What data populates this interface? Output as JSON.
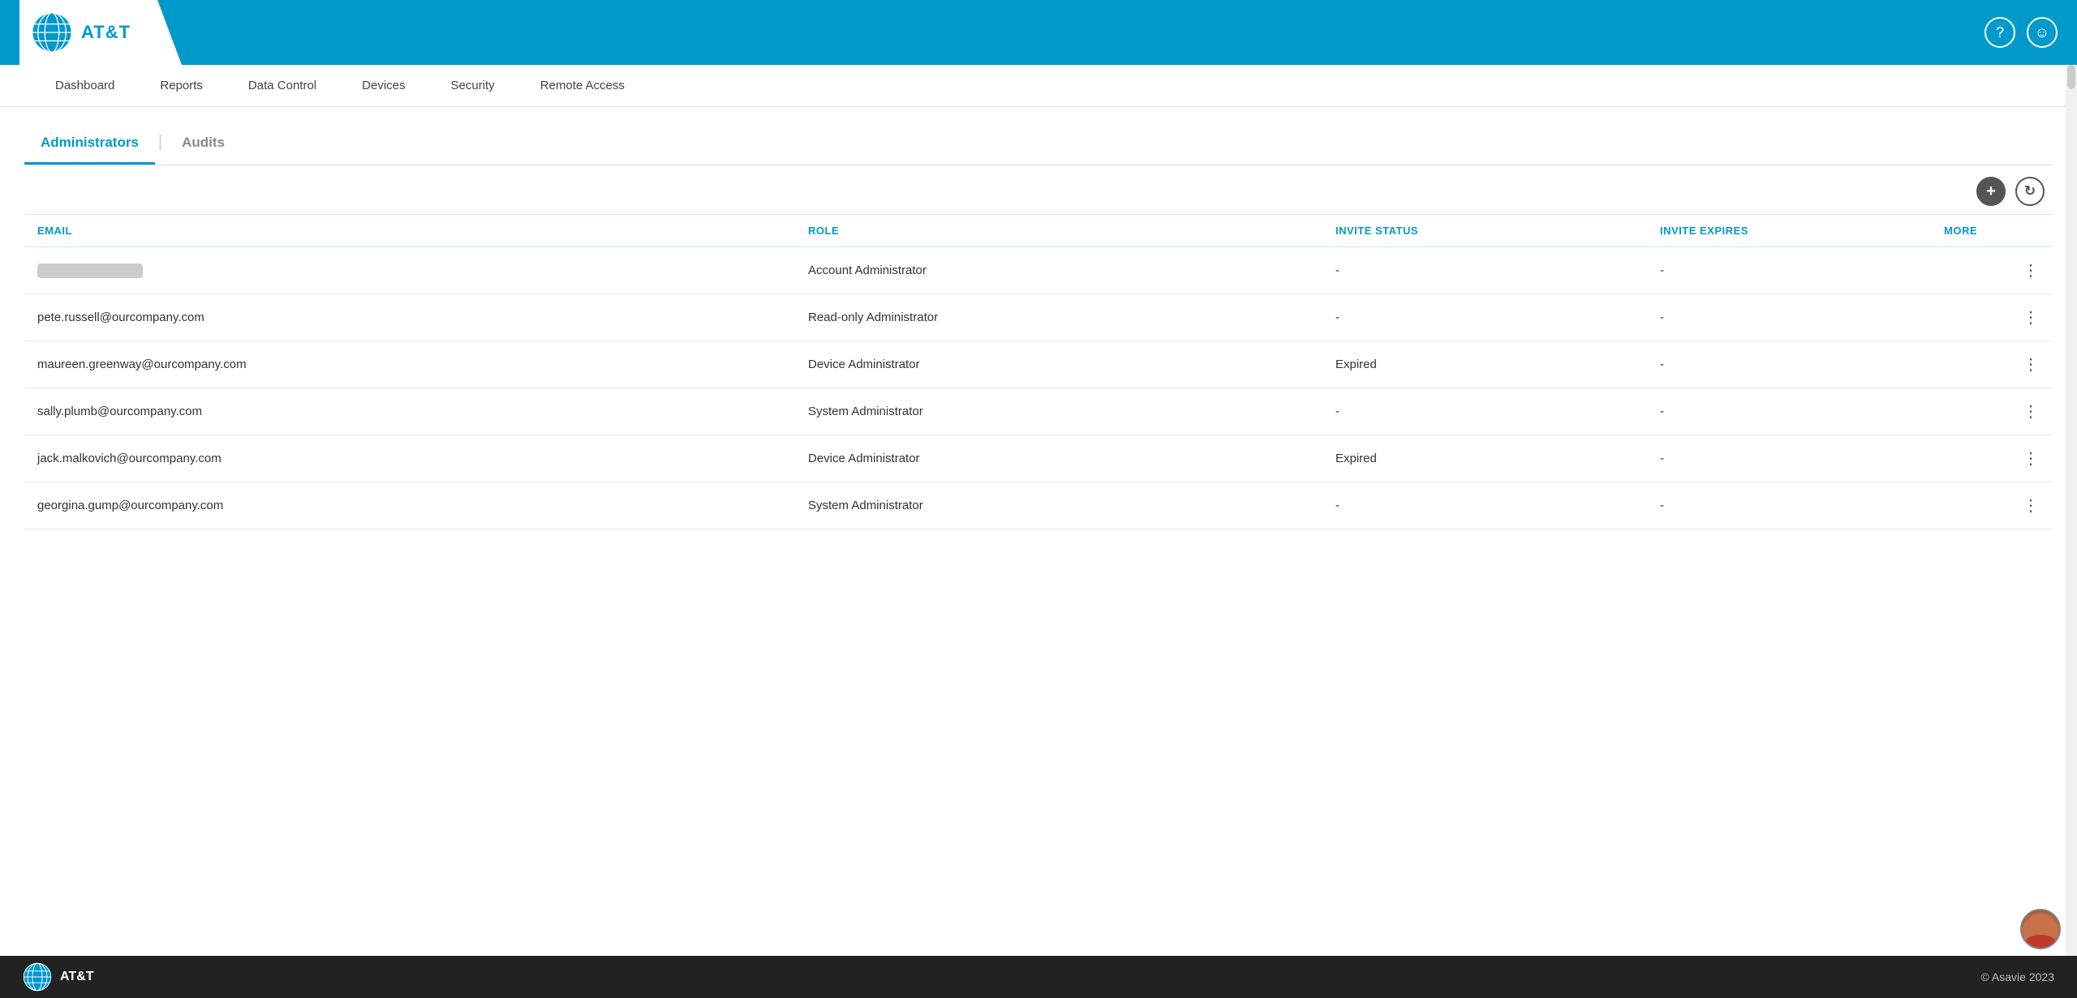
{
  "header": {
    "logo_text": "AT&T",
    "help_icon": "?",
    "user_icon": "person"
  },
  "nav": {
    "items": [
      {
        "label": "Dashboard",
        "key": "dashboard"
      },
      {
        "label": "Reports",
        "key": "reports"
      },
      {
        "label": "Data Control",
        "key": "data-control"
      },
      {
        "label": "Devices",
        "key": "devices"
      },
      {
        "label": "Security",
        "key": "security"
      },
      {
        "label": "Remote Access",
        "key": "remote-access"
      }
    ]
  },
  "tabs": [
    {
      "label": "Administrators",
      "active": true
    },
    {
      "label": "Audits",
      "active": false
    }
  ],
  "toolbar": {
    "add_label": "+",
    "refresh_label": "↻"
  },
  "table": {
    "columns": [
      {
        "key": "email",
        "label": "EMAIL"
      },
      {
        "key": "role",
        "label": "ROLE"
      },
      {
        "key": "invite_status",
        "label": "INVITE STATUS"
      },
      {
        "key": "invite_expires",
        "label": "INVITE EXPIRES"
      },
      {
        "key": "more",
        "label": "MORE"
      }
    ],
    "rows": [
      {
        "email": null,
        "email_blurred": true,
        "role": "Account Administrator",
        "role_muted": true,
        "invite_status": "-",
        "invite_expires": "-",
        "more": "⋮"
      },
      {
        "email": "pete.russell@ourcompany.com",
        "email_blurred": false,
        "role": "Read-only Administrator",
        "role_muted": false,
        "invite_status": "-",
        "invite_expires": "-",
        "more": "⋮"
      },
      {
        "email": "maureen.greenway@ourcompany.com",
        "email_blurred": false,
        "role": "Device Administrator",
        "role_muted": false,
        "invite_status": "Expired",
        "invite_expires": "-",
        "more": "⋮"
      },
      {
        "email": "sally.plumb@ourcompany.com",
        "email_blurred": false,
        "role": "System Administrator",
        "role_muted": false,
        "invite_status": "-",
        "invite_expires": "-",
        "more": "⋮"
      },
      {
        "email": "jack.malkovich@ourcompany.com",
        "email_blurred": false,
        "role": "Device Administrator",
        "role_muted": false,
        "invite_status": "Expired",
        "invite_expires": "-",
        "more": "⋮"
      },
      {
        "email": "georgina.gump@ourcompany.com",
        "email_blurred": false,
        "role": "System Administrator",
        "role_muted": false,
        "invite_status": "-",
        "invite_expires": "-",
        "more": "⋮"
      }
    ]
  },
  "footer": {
    "logo_text": "AT&T",
    "copyright": "© Asavie 2023"
  }
}
